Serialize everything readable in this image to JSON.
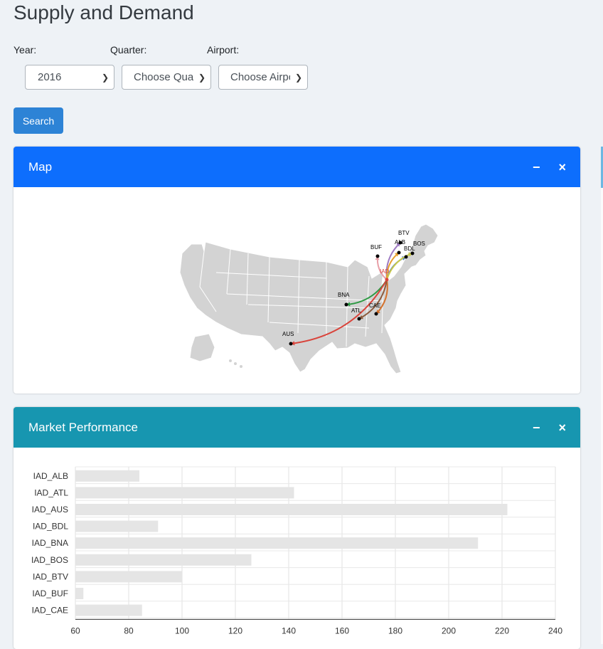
{
  "page_title": "Supply and Demand",
  "filters": {
    "year_label": "Year:",
    "year_value": "2016",
    "quarter_label": "Quarter:",
    "quarter_value": "Choose Quarter",
    "airport_label": "Airport:",
    "airport_value": "Choose Airport"
  },
  "search_label": "Search",
  "map_card": {
    "title": "Map",
    "header_color": "#0d6efd",
    "minimize_glyph": "−",
    "close_glyph": "×",
    "hub": "IAD",
    "airports": [
      "BTV",
      "BUF",
      "ALB",
      "BDL",
      "BOS",
      "BNA",
      "ATL",
      "CAE",
      "AUS"
    ],
    "route_colors": [
      "#e8a0a8",
      "#3b6ec9",
      "#2e9a44",
      "#d4712c",
      "#c9c94a",
      "#d9443b",
      "#a07cc4",
      "#8c5a3c",
      "#e8a030"
    ]
  },
  "perf_card": {
    "title": "Market Performance",
    "header_color": "#1796b0",
    "minimize_glyph": "−",
    "close_glyph": "×"
  },
  "chart_data": {
    "type": "bar",
    "orientation": "horizontal",
    "categories": [
      "IAD_ALB",
      "IAD_ATL",
      "IAD_AUS",
      "IAD_BDL",
      "IAD_BNA",
      "IAD_BOS",
      "IAD_BTV",
      "IAD_BUF",
      "IAD_CAE"
    ],
    "values": [
      84,
      142,
      222,
      91,
      211,
      126,
      100,
      63,
      85
    ],
    "xlim": [
      60,
      240
    ],
    "xticks": [
      60,
      80,
      100,
      120,
      140,
      160,
      180,
      200,
      220,
      240
    ],
    "grid": true,
    "bar_color": "#e5e5e5",
    "title": "",
    "xlabel": "",
    "ylabel": ""
  }
}
